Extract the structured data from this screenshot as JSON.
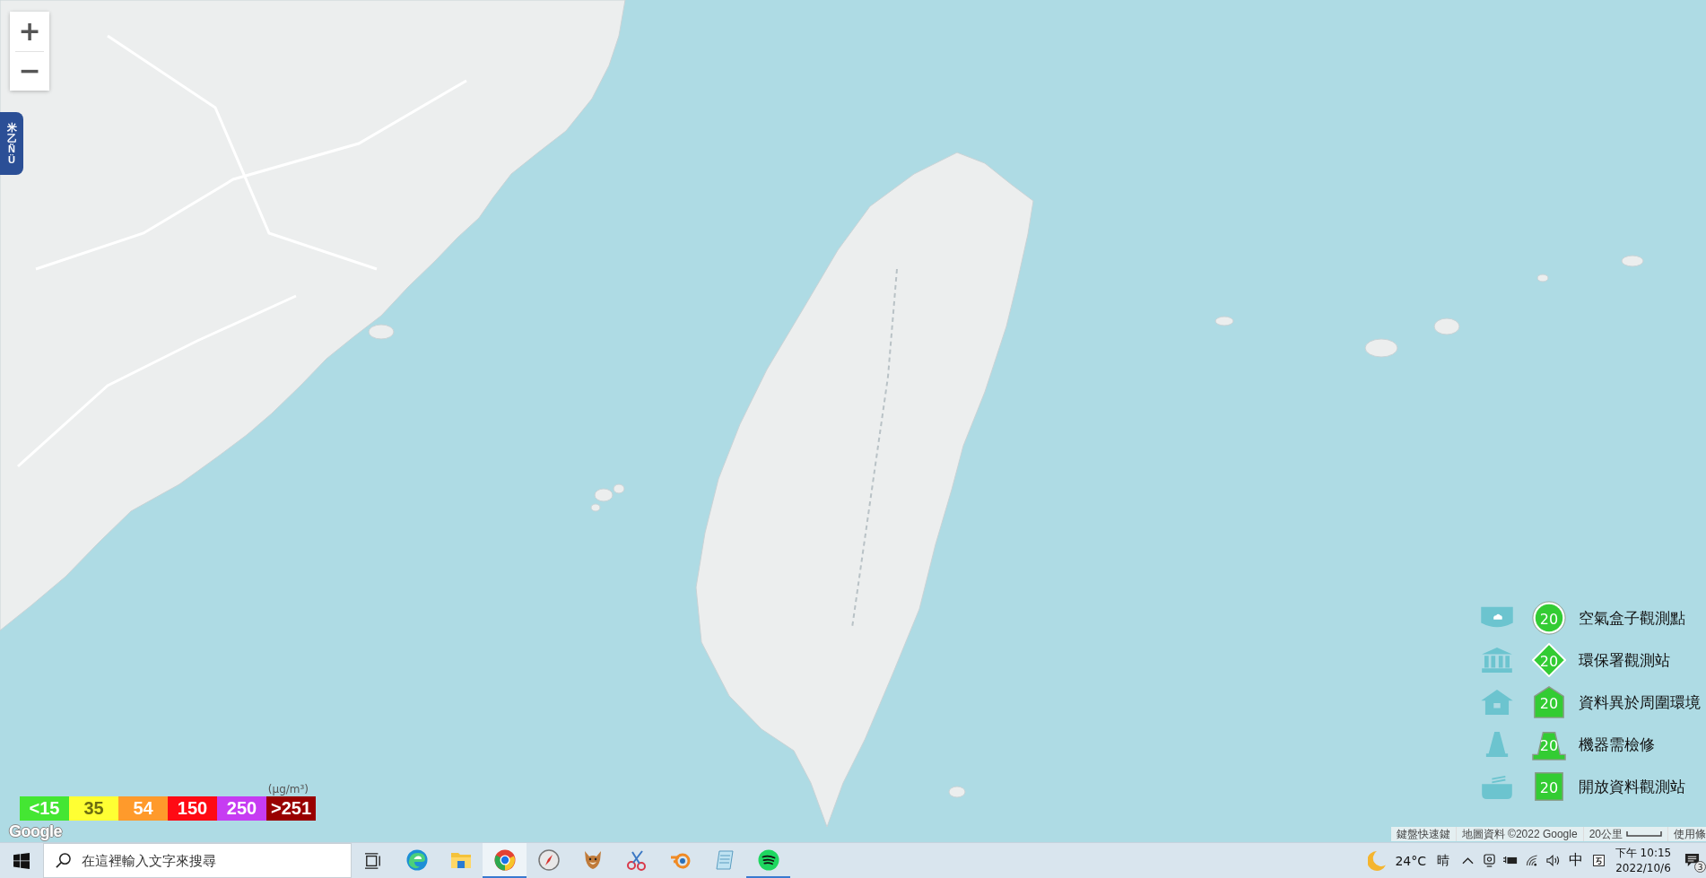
{
  "map": {
    "zoom_controls": [
      "+",
      "−"
    ],
    "side_tab": "米乙ÑÜ"
  },
  "color_scale": {
    "unit": "(μg/m³)",
    "items": [
      {
        "label": "<15",
        "color": "#44e633"
      },
      {
        "label": "35",
        "color": "#ffff33"
      },
      {
        "label": "54",
        "color": "#ff9a2b"
      },
      {
        "label": "150",
        "color": "#ff0a14"
      },
      {
        "label": "250",
        "color": "#c63cf2"
      },
      {
        "label": ">251",
        "color": "#990000"
      }
    ]
  },
  "map_logo": "Google",
  "legend": [
    {
      "kind": "circle",
      "value": "20",
      "label": "空氣盒子觀測點"
    },
    {
      "kind": "diamond",
      "value": "20",
      "label": "環保署觀測站"
    },
    {
      "kind": "house",
      "value": "20",
      "label": "資料異於周圍環境"
    },
    {
      "kind": "cone",
      "value": "20",
      "label": "機器需檢修"
    },
    {
      "kind": "square",
      "value": "20",
      "label": "開放資料觀測站"
    }
  ],
  "attribution": {
    "shortcuts": "鍵盤快速鍵",
    "map_data": "地圖資料 ©2022 Google",
    "scale": "20公里",
    "terms": "使用條"
  },
  "taskbar": {
    "search": {
      "placeholder": "在這裡輸入文字來搜尋"
    },
    "apps": [
      {
        "kind": "wave",
        "active": false,
        "running": false
      },
      {
        "kind": "folder",
        "active": false,
        "running": false
      },
      {
        "kind": "ring",
        "active": true,
        "running": true
      },
      {
        "kind": "compass",
        "active": false,
        "running": false
      },
      {
        "kind": "fox",
        "active": false,
        "running": false
      },
      {
        "kind": "scissors",
        "active": false,
        "running": false
      },
      {
        "kind": "orbit",
        "active": false,
        "running": false
      },
      {
        "kind": "notepad",
        "active": false,
        "running": false
      },
      {
        "kind": "bars",
        "active": false,
        "running": true
      }
    ],
    "weather": {
      "temperature": "24°C",
      "condition": "晴"
    },
    "input_mode": "中",
    "time": "下午 10:15",
    "date": "2022/10/6",
    "notifications": "3"
  }
}
